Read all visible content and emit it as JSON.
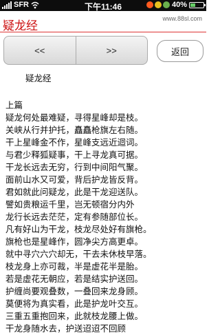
{
  "status": {
    "carrier": "SFR",
    "time": "下午11:46",
    "battery": "40%",
    "battery_level": 0.4,
    "indicator_colors": [
      "#ff5a1f",
      "#e8c020",
      "#6ab04c"
    ]
  },
  "header": {
    "title": "疑龙经",
    "watermark": "www.88sl.com"
  },
  "nav": {
    "prev_label": "<<",
    "next_label": ">>",
    "back_label": "返回"
  },
  "content": {
    "title": "疑龙经",
    "section": "上篇",
    "lines": [
      "疑龙何处最难疑，寻得星峰却是枝。",
      "关峡从行并护托，矗矗枪旗左右随。",
      "干上星峰金不作，星峰支远近迴词。",
      "与君少释狐疑事，干上寻龙真可据。",
      "干龙长远去无穷，行到中间阳气聚。",
      "面前山水又可爱，背后护龙皆反背。",
      "君如就此问疑龙，此是干龙迎送队。",
      "譬如贵粮运千里，岂无顿宿分内外",
      "龙行长远去茫茫，定有参随部位长。",
      "凡有好山为干龙，枝龙尽处好有旗枪。",
      "旗枪也是星峰作，圆净尖方高更卓。",
      "就中寻穴六穴却无，干去未休枝早落。",
      "枝龙身上亦可裁，半是虚花半是胎。",
      "若是虚花无朝应，若是结实护送回。",
      "护缠尚要观叠数，一叠回来龙身顾。",
      "莫便将为真实看，此是护龙叶交互。",
      "三重五重抱回来，此就枝龙腰上做。",
      "干龙身随水去，护送迢迢不回顾"
    ]
  }
}
